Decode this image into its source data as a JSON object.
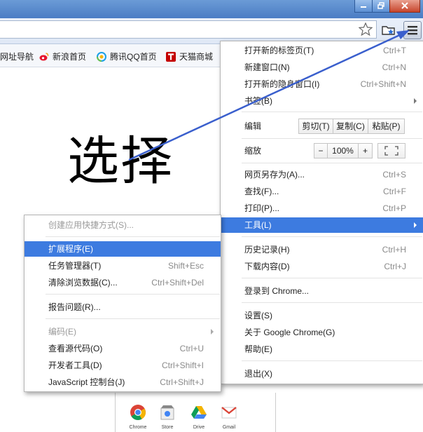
{
  "bookmarks": [
    {
      "label": "网址导航",
      "icon": "folder-icon"
    },
    {
      "label": "新浪首页",
      "icon": "weibo-icon"
    },
    {
      "label": "腾讯QQ首页",
      "icon": "qq-icon"
    },
    {
      "label": "天猫商城",
      "icon": "tmall-icon"
    }
  ],
  "page_text": "选择",
  "apps": [
    "Chrome",
    "Store",
    "Drive",
    "Gmail"
  ],
  "main_menu": {
    "new_tab": {
      "label": "打开新的标签页(T)",
      "shortcut": "Ctrl+T"
    },
    "new_window": {
      "label": "新建窗口(N)",
      "shortcut": "Ctrl+N"
    },
    "incognito": {
      "label": "打开新的隐身窗口(I)",
      "shortcut": "Ctrl+Shift+N"
    },
    "bookmarks": {
      "label": "书签(B)"
    },
    "edit": {
      "label": "编辑",
      "cut": "剪切(T)",
      "copy": "复制(C)",
      "paste": "粘贴(P)"
    },
    "zoom": {
      "label": "缩放",
      "minus": "−",
      "value": "100%",
      "plus": "+"
    },
    "save_as": {
      "label": "网页另存为(A)...",
      "shortcut": "Ctrl+S"
    },
    "find": {
      "label": "查找(F)...",
      "shortcut": "Ctrl+F"
    },
    "print": {
      "label": "打印(P)...",
      "shortcut": "Ctrl+P"
    },
    "tools": {
      "label": "工具(L)"
    },
    "history": {
      "label": "历史记录(H)",
      "shortcut": "Ctrl+H"
    },
    "downloads": {
      "label": "下载内容(D)",
      "shortcut": "Ctrl+J"
    },
    "signin": {
      "label": "登录到 Chrome..."
    },
    "settings": {
      "label": "设置(S)"
    },
    "about": {
      "label": "关于 Google Chrome(G)"
    },
    "help": {
      "label": "帮助(E)"
    },
    "exit": {
      "label": "退出(X)"
    }
  },
  "tools_menu": {
    "create_shortcut": {
      "label": "创建应用快捷方式(S)..."
    },
    "extensions": {
      "label": "扩展程序(E)"
    },
    "task_manager": {
      "label": "任务管理器(T)",
      "shortcut": "Shift+Esc"
    },
    "clear_data": {
      "label": "清除浏览数据(C)...",
      "shortcut": "Ctrl+Shift+Del"
    },
    "report_issue": {
      "label": "报告问题(R)..."
    },
    "encoding": {
      "label": "编码(E)"
    },
    "view_source": {
      "label": "查看源代码(O)",
      "shortcut": "Ctrl+U"
    },
    "dev_tools": {
      "label": "开发者工具(D)",
      "shortcut": "Ctrl+Shift+I"
    },
    "js_console": {
      "label": "JavaScript 控制台(J)",
      "shortcut": "Ctrl+Shift+J"
    }
  },
  "colors": {
    "highlight": "#3d7be0",
    "annotation_arrow": "#3a5fcd",
    "titlebar": "#4a7cc4"
  }
}
